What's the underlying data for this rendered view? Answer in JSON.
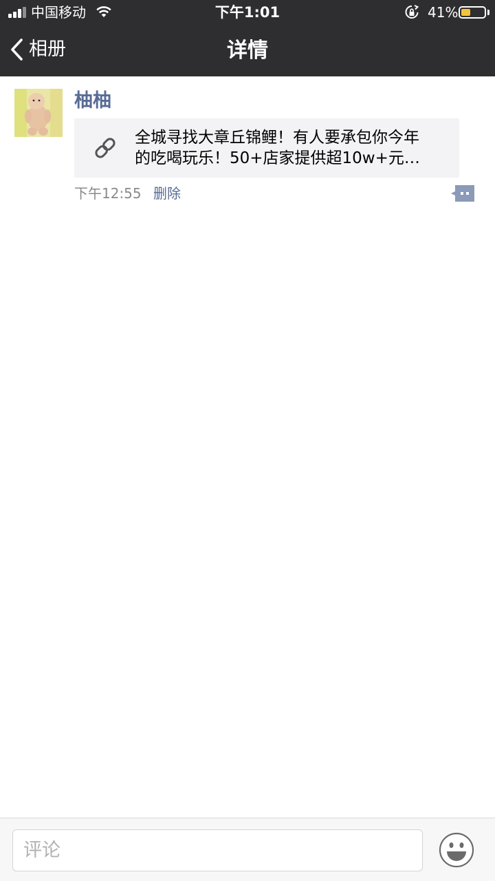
{
  "status_bar": {
    "carrier": "中国移动",
    "time": "下午1:01",
    "battery_percent": "41%",
    "battery_level": 0.41,
    "battery_color": "#f3c339"
  },
  "nav": {
    "back_label": "相册",
    "title": "详情"
  },
  "post": {
    "username": "柚柚",
    "link_text_line1": "全城寻找大章丘锦鲤！有人要承包你今年",
    "link_text_line2": "的吃喝玩乐！50+店家提供超10w+元…",
    "time": "下午12:55",
    "delete_label": "删除"
  },
  "comment_bar": {
    "placeholder": "评论"
  },
  "colors": {
    "header_bg": "#2e2e31",
    "link_blue": "#576b95",
    "card_bg": "#f3f3f5"
  },
  "icons": [
    "signal-icon",
    "wifi-icon",
    "rotation-lock-icon",
    "battery-icon",
    "back-chevron-icon",
    "link-icon",
    "comment-icon",
    "emoji-icon"
  ]
}
